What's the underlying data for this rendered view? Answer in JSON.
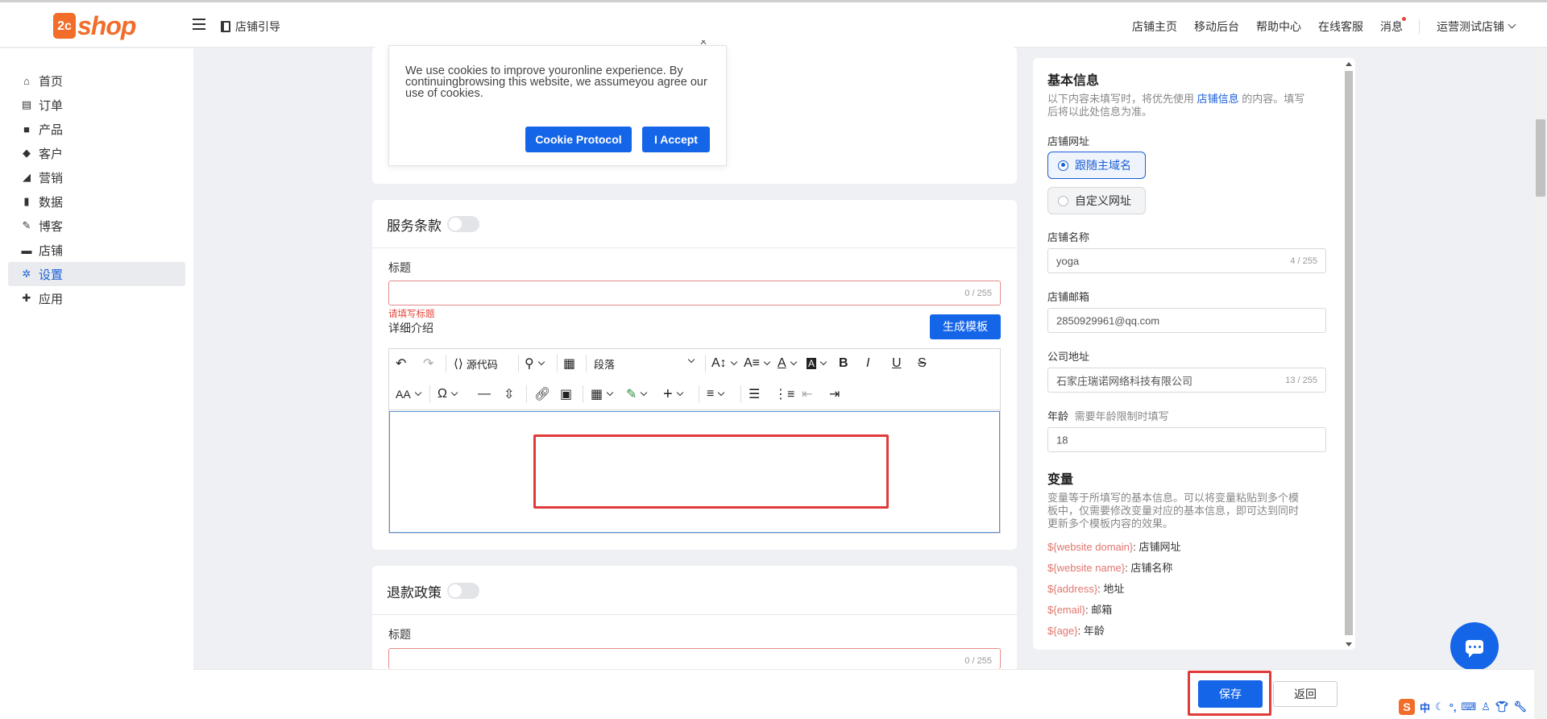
{
  "header": {
    "logo_mark": "2c",
    "logo_word": "shop",
    "guide_label": "店铺引导",
    "nav": [
      "店铺主页",
      "移动后台",
      "帮助中心",
      "在线客服",
      "消息"
    ],
    "store_name": "运营测试店铺"
  },
  "sidebar": {
    "items": [
      {
        "label": "首页",
        "icon": "home-icon"
      },
      {
        "label": "订单",
        "icon": "clipboard-icon"
      },
      {
        "label": "产品",
        "icon": "bag-icon"
      },
      {
        "label": "客户",
        "icon": "diamond-icon"
      },
      {
        "label": "营销",
        "icon": "tag-icon"
      },
      {
        "label": "数据",
        "icon": "bar-chart-icon"
      },
      {
        "label": "博客",
        "icon": "edit-icon"
      },
      {
        "label": "店铺",
        "icon": "store-icon"
      },
      {
        "label": "设置",
        "icon": "gear-icon"
      },
      {
        "label": "应用",
        "icon": "puzzle-icon"
      }
    ],
    "active": "设置"
  },
  "cookie": {
    "text": "We use cookies to improve youronline experience. By continuingbrowsing this website, we assumeyou agree our use of cookies.",
    "protocol_label": "Cookie Protocol",
    "accept_label": "I Accept"
  },
  "terms": {
    "title": "服务条款",
    "title_label": "标题",
    "title_count": "0 / 255",
    "error": "请填写标题",
    "detail_label": "详细介绍",
    "generate_label": "生成模板",
    "source_label": "源代码",
    "paragraph_label": "段落"
  },
  "refund": {
    "title": "退款政策",
    "title_label": "标题",
    "title_count": "0 / 255"
  },
  "basic": {
    "title": "基本信息",
    "desc_prefix": "以下内容未填写时，将优先使用",
    "desc_link": "店铺信息",
    "desc_line1_suffix": "的内容。填写",
    "desc_line2": "后将以此处信息为准。",
    "url_label": "店铺网址",
    "url_options": [
      "跟随主域名",
      "自定义网址"
    ],
    "name_label": "店铺名称",
    "name_value": "yoga",
    "name_count": "4 / 255",
    "email_label": "店铺邮箱",
    "email_value": "2850929961@qq.com",
    "address_label": "公司地址",
    "address_value": "石家庄瑞诺网络科技有限公司",
    "address_count": "13 / 255",
    "age_label": "年龄",
    "age_hint": "需要年龄限制时填写",
    "age_value": "18"
  },
  "variables": {
    "title": "变量",
    "desc_lines": [
      "变量等于所填写的基本信息。可以将变量粘贴到多个模",
      "板中，仅需要修改变量对应的基本信息，即可达到同时",
      "更新多个模板内容的效果。"
    ],
    "items": [
      {
        "key": "${website domain}",
        "label": ": 店铺网址"
      },
      {
        "key": "${website name}",
        "label": ": 店铺名称"
      },
      {
        "key": "${address}",
        "label": ": 地址"
      },
      {
        "key": "${email}",
        "label": ": 邮箱"
      },
      {
        "key": "${age}",
        "label": ": 年龄"
      }
    ]
  },
  "footer": {
    "save_label": "保存",
    "back_label": "返回"
  },
  "ime": {
    "logo": "S",
    "mode": "中"
  },
  "colors": {
    "brand_orange": "#f26c2a",
    "primary_blue": "#1565e8",
    "error_red": "#e4463b"
  }
}
